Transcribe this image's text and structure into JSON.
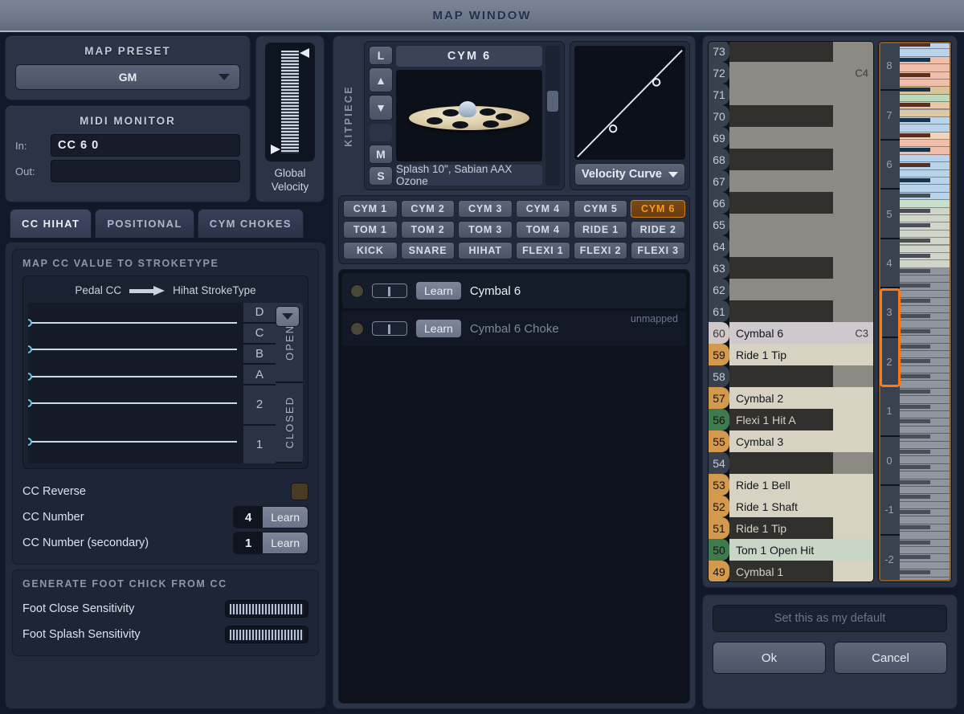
{
  "window": {
    "title": "MAP WINDOW"
  },
  "map_preset": {
    "title": "MAP PRESET",
    "selected": "GM",
    "caret_icon": "chevron-down-icon"
  },
  "midi_monitor": {
    "title": "MIDI MONITOR",
    "in_label": "In:",
    "in_value": "CC 6 0",
    "out_label": "Out:",
    "out_value": ""
  },
  "global_velocity": {
    "label_line1": "Global",
    "label_line2": "Velocity"
  },
  "tabs": [
    {
      "label": "CC HIHAT",
      "active": true
    },
    {
      "label": "POSITIONAL",
      "active": false
    },
    {
      "label": "CYM CHOKES",
      "active": false
    }
  ],
  "cc_hihat": {
    "section_title": "MAP CC VALUE TO STROKETYPE",
    "from_label": "Pedal CC",
    "to_label": "Hihat StrokeType",
    "arrow_icon": "arrow-right-icon",
    "dropdown_icon": "chevron-down-icon",
    "stroke_letters": [
      "D",
      "C",
      "B",
      "A",
      "2",
      "1"
    ],
    "groups": [
      {
        "label": "OPEN",
        "rows": 4
      },
      {
        "label": "CLOSED",
        "rows": 2
      }
    ],
    "lane_positions": [
      24,
      57,
      91,
      124,
      190
    ],
    "options": {
      "cc_reverse_label": "CC Reverse",
      "cc_reverse_checked": false,
      "cc_number_label": "CC Number",
      "cc_number_value": "4",
      "cc_number_learn": "Learn",
      "cc_number_secondary_label": "CC Number (secondary)",
      "cc_number_secondary_value": "1",
      "cc_number_secondary_learn": "Learn"
    },
    "foot_chick": {
      "title": "GENERATE FOOT CHICK FROM CC",
      "rows": [
        {
          "label": "Foot Close Sensitivity"
        },
        {
          "label": "Foot Splash Sensitivity"
        }
      ]
    }
  },
  "kitpiece": {
    "label": "KITPIECE",
    "name": "CYM 6",
    "description": "Splash 10\", Sabian AAX Ozone",
    "side_buttons": [
      "L",
      "▲",
      "▼",
      "M",
      "S"
    ],
    "velocity_curve": {
      "label": "Velocity Curve",
      "caret_icon": "chevron-down-icon"
    },
    "buttons": [
      "CYM 1",
      "CYM 2",
      "CYM 3",
      "CYM 4",
      "CYM 5",
      "CYM 6",
      "TOM 1",
      "TOM 2",
      "TOM 3",
      "TOM 4",
      "RIDE 1",
      "RIDE 2",
      "KICK",
      "SNARE",
      "HIHAT",
      "FLEXI 1",
      "FLEXI 2",
      "FLEXI 3"
    ],
    "selected_button": "CYM 6",
    "map_rows": [
      {
        "name": "Cymbal 6",
        "learn": "Learn",
        "status": "",
        "dim": false
      },
      {
        "name": "Cymbal 6 Choke",
        "learn": "Learn",
        "status": "unmapped",
        "dim": true
      }
    ]
  },
  "piano_roll": {
    "notes": [
      {
        "num": "73",
        "label": "",
        "key": "black",
        "octave": ""
      },
      {
        "num": "72",
        "label": "",
        "key": "white",
        "octave": "C4"
      },
      {
        "num": "71",
        "label": "",
        "key": "white",
        "octave": ""
      },
      {
        "num": "70",
        "label": "",
        "key": "black",
        "octave": ""
      },
      {
        "num": "69",
        "label": "",
        "key": "white",
        "octave": ""
      },
      {
        "num": "68",
        "label": "",
        "key": "black",
        "octave": ""
      },
      {
        "num": "67",
        "label": "",
        "key": "white",
        "octave": ""
      },
      {
        "num": "66",
        "label": "",
        "key": "black",
        "octave": ""
      },
      {
        "num": "65",
        "label": "",
        "key": "white",
        "octave": ""
      },
      {
        "num": "64",
        "label": "",
        "key": "white",
        "octave": ""
      },
      {
        "num": "63",
        "label": "",
        "key": "black",
        "octave": ""
      },
      {
        "num": "62",
        "label": "",
        "key": "white",
        "octave": ""
      },
      {
        "num": "61",
        "label": "",
        "key": "black",
        "octave": ""
      },
      {
        "num": "60",
        "label": "Cymbal 6",
        "key": "selected",
        "octave": "C3"
      },
      {
        "num": "59",
        "label": "Ride 1 Tip",
        "key": "white",
        "octave": ""
      },
      {
        "num": "58",
        "label": "",
        "key": "black",
        "octave": ""
      },
      {
        "num": "57",
        "label": "Cymbal 2",
        "key": "white",
        "octave": ""
      },
      {
        "num": "56",
        "label": "Flexi 1 Hit A",
        "key": "black",
        "octave": ""
      },
      {
        "num": "55",
        "label": "Cymbal 3",
        "key": "white",
        "octave": ""
      },
      {
        "num": "54",
        "label": "",
        "key": "black",
        "octave": ""
      },
      {
        "num": "53",
        "label": "Ride 1 Bell",
        "key": "white",
        "octave": ""
      },
      {
        "num": "52",
        "label": "Ride 1 Shaft",
        "key": "white",
        "octave": ""
      },
      {
        "num": "51",
        "label": "Ride 1 Tip",
        "key": "black",
        "octave": ""
      },
      {
        "num": "50",
        "label": "Tom 1 Open Hit",
        "key": "white-green",
        "octave": ""
      },
      {
        "num": "49",
        "label": "Cymbal 1",
        "key": "black",
        "octave": ""
      }
    ],
    "badge_colors": {
      "59": "#d39a4e",
      "57": "#d39a4e",
      "55": "#d39a4e",
      "53": "#d39a4e",
      "52": "#d39a4e",
      "51": "#d39a4e",
      "49": "#d39a4e",
      "56": "#3f7a4e",
      "50": "#3f7a4e",
      "60": "#cfc8c6"
    },
    "minimap_octaves": [
      "8",
      "7",
      "6",
      "5",
      "4",
      "3",
      "2",
      "1",
      "0",
      "-1",
      "-2"
    ],
    "minimap_selected": [
      "3",
      "2"
    ],
    "selection_color": "#ff7a12"
  },
  "actions": {
    "set_default": "Set this as my default",
    "ok": "Ok",
    "cancel": "Cancel"
  }
}
